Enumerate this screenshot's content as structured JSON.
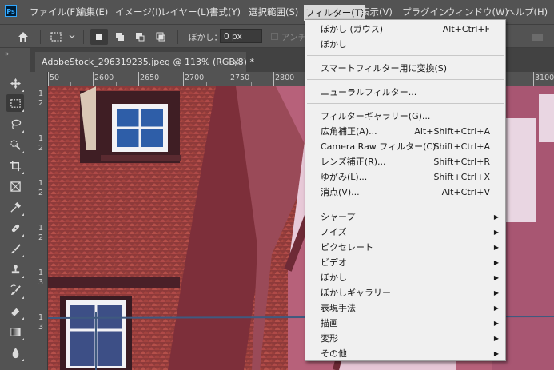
{
  "app": {
    "logo_text": "Ps"
  },
  "menubar": {
    "items": [
      "ファイル(F)",
      "編集(E)",
      "イメージ(I)",
      "レイヤー(L)",
      "書式(Y)",
      "選択範囲(S)",
      "フィルター(T)",
      "表示(V)",
      "プラグイン",
      "ウィンドウ(W)",
      "ヘルプ(H)"
    ],
    "active_index": 6
  },
  "options": {
    "feather_label": "ぼかし：",
    "feather_value": "0 px",
    "antialias_label": "アンチ"
  },
  "document": {
    "tab_title": "AdobeStock_296319235.jpeg @ 113% (RGB/8) *",
    "close_glyph": "×"
  },
  "ruler": {
    "h_ticks": [
      "50",
      "2600",
      "2650",
      "2700",
      "2750",
      "2800",
      "3100"
    ],
    "v_ticks": [
      "1",
      "2",
      "1",
      "2",
      "1",
      "2",
      "1",
      "2",
      "1",
      "3",
      "1",
      "3"
    ]
  },
  "filter_menu": {
    "groups": [
      [
        {
          "label": "ぼかし (ガウス)",
          "shortcut": "Alt+Ctrl+F"
        },
        {
          "label": "ぼかし",
          "shortcut": ""
        }
      ],
      [
        {
          "label": "スマートフィルター用に変換(S)",
          "shortcut": ""
        }
      ],
      [
        {
          "label": "ニューラルフィルター...",
          "shortcut": ""
        }
      ],
      [
        {
          "label": "フィルターギャラリー(G)...",
          "shortcut": ""
        },
        {
          "label": "広角補正(A)...",
          "shortcut": "Alt+Shift+Ctrl+A"
        },
        {
          "label": "Camera Raw フィルター(C)...",
          "shortcut": "Shift+Ctrl+A"
        },
        {
          "label": "レンズ補正(R)...",
          "shortcut": "Shift+Ctrl+R"
        },
        {
          "label": "ゆがみ(L)...",
          "shortcut": "Shift+Ctrl+X"
        },
        {
          "label": "消点(V)...",
          "shortcut": "Alt+Ctrl+V"
        }
      ],
      [
        {
          "label": "シャープ",
          "submenu": true
        },
        {
          "label": "ノイズ",
          "submenu": true
        },
        {
          "label": "ピクセレート",
          "submenu": true
        },
        {
          "label": "ビデオ",
          "submenu": true
        },
        {
          "label": "ぼかし",
          "submenu": true
        },
        {
          "label": "ぼかしギャラリー",
          "submenu": true
        },
        {
          "label": "表現手法",
          "submenu": true
        },
        {
          "label": "描画",
          "submenu": true
        },
        {
          "label": "変形",
          "submenu": true
        },
        {
          "label": "その他",
          "submenu": true
        }
      ]
    ],
    "submenu_glyph": "▶"
  },
  "tools": [
    "move-tool",
    "marquee-tool",
    "lasso-tool",
    "quick-select-tool",
    "crop-tool",
    "frame-tool",
    "eyedropper-tool",
    "healing-tool",
    "brush-tool",
    "stamp-tool",
    "history-brush-tool",
    "eraser-tool",
    "gradient-tool",
    "blur-tool"
  ],
  "colors": {
    "menubar": "#535353",
    "menu_bg": "#f0f0f0",
    "active_menu": "#d9d9d9",
    "accent": "#31a8ff"
  }
}
